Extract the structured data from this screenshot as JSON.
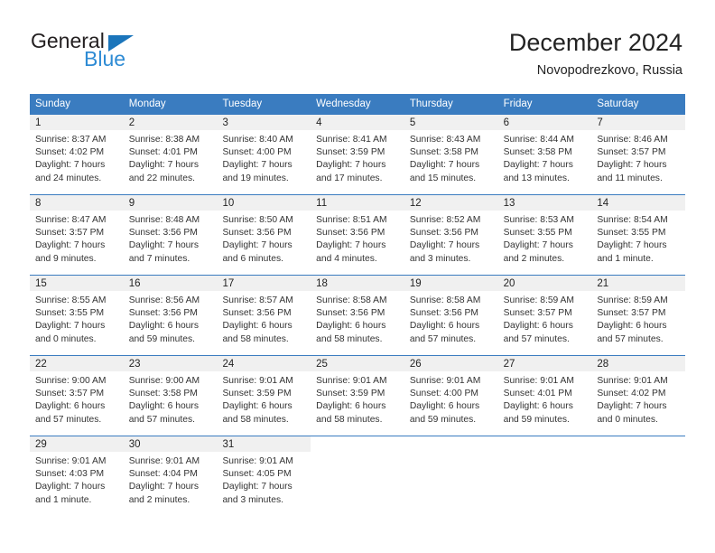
{
  "brand": {
    "name_part1": "General",
    "name_part2": "Blue",
    "accent_color": "#2e8bd4",
    "triangle_color": "#1b75bb"
  },
  "header": {
    "title": "December 2024",
    "subtitle": "Novopodrezkovo, Russia"
  },
  "calendar": {
    "header_bg": "#3a7cc0",
    "daynum_bg": "#f0f0f0",
    "weekdays": [
      "Sunday",
      "Monday",
      "Tuesday",
      "Wednesday",
      "Thursday",
      "Friday",
      "Saturday"
    ],
    "weeks": [
      [
        {
          "day": "1",
          "lines": [
            "Sunrise: 8:37 AM",
            "Sunset: 4:02 PM",
            "Daylight: 7 hours",
            "and 24 minutes."
          ]
        },
        {
          "day": "2",
          "lines": [
            "Sunrise: 8:38 AM",
            "Sunset: 4:01 PM",
            "Daylight: 7 hours",
            "and 22 minutes."
          ]
        },
        {
          "day": "3",
          "lines": [
            "Sunrise: 8:40 AM",
            "Sunset: 4:00 PM",
            "Daylight: 7 hours",
            "and 19 minutes."
          ]
        },
        {
          "day": "4",
          "lines": [
            "Sunrise: 8:41 AM",
            "Sunset: 3:59 PM",
            "Daylight: 7 hours",
            "and 17 minutes."
          ]
        },
        {
          "day": "5",
          "lines": [
            "Sunrise: 8:43 AM",
            "Sunset: 3:58 PM",
            "Daylight: 7 hours",
            "and 15 minutes."
          ]
        },
        {
          "day": "6",
          "lines": [
            "Sunrise: 8:44 AM",
            "Sunset: 3:58 PM",
            "Daylight: 7 hours",
            "and 13 minutes."
          ]
        },
        {
          "day": "7",
          "lines": [
            "Sunrise: 8:46 AM",
            "Sunset: 3:57 PM",
            "Daylight: 7 hours",
            "and 11 minutes."
          ]
        }
      ],
      [
        {
          "day": "8",
          "lines": [
            "Sunrise: 8:47 AM",
            "Sunset: 3:57 PM",
            "Daylight: 7 hours",
            "and 9 minutes."
          ]
        },
        {
          "day": "9",
          "lines": [
            "Sunrise: 8:48 AM",
            "Sunset: 3:56 PM",
            "Daylight: 7 hours",
            "and 7 minutes."
          ]
        },
        {
          "day": "10",
          "lines": [
            "Sunrise: 8:50 AM",
            "Sunset: 3:56 PM",
            "Daylight: 7 hours",
            "and 6 minutes."
          ]
        },
        {
          "day": "11",
          "lines": [
            "Sunrise: 8:51 AM",
            "Sunset: 3:56 PM",
            "Daylight: 7 hours",
            "and 4 minutes."
          ]
        },
        {
          "day": "12",
          "lines": [
            "Sunrise: 8:52 AM",
            "Sunset: 3:56 PM",
            "Daylight: 7 hours",
            "and 3 minutes."
          ]
        },
        {
          "day": "13",
          "lines": [
            "Sunrise: 8:53 AM",
            "Sunset: 3:55 PM",
            "Daylight: 7 hours",
            "and 2 minutes."
          ]
        },
        {
          "day": "14",
          "lines": [
            "Sunrise: 8:54 AM",
            "Sunset: 3:55 PM",
            "Daylight: 7 hours",
            "and 1 minute."
          ]
        }
      ],
      [
        {
          "day": "15",
          "lines": [
            "Sunrise: 8:55 AM",
            "Sunset: 3:55 PM",
            "Daylight: 7 hours",
            "and 0 minutes."
          ]
        },
        {
          "day": "16",
          "lines": [
            "Sunrise: 8:56 AM",
            "Sunset: 3:56 PM",
            "Daylight: 6 hours",
            "and 59 minutes."
          ]
        },
        {
          "day": "17",
          "lines": [
            "Sunrise: 8:57 AM",
            "Sunset: 3:56 PM",
            "Daylight: 6 hours",
            "and 58 minutes."
          ]
        },
        {
          "day": "18",
          "lines": [
            "Sunrise: 8:58 AM",
            "Sunset: 3:56 PM",
            "Daylight: 6 hours",
            "and 58 minutes."
          ]
        },
        {
          "day": "19",
          "lines": [
            "Sunrise: 8:58 AM",
            "Sunset: 3:56 PM",
            "Daylight: 6 hours",
            "and 57 minutes."
          ]
        },
        {
          "day": "20",
          "lines": [
            "Sunrise: 8:59 AM",
            "Sunset: 3:57 PM",
            "Daylight: 6 hours",
            "and 57 minutes."
          ]
        },
        {
          "day": "21",
          "lines": [
            "Sunrise: 8:59 AM",
            "Sunset: 3:57 PM",
            "Daylight: 6 hours",
            "and 57 minutes."
          ]
        }
      ],
      [
        {
          "day": "22",
          "lines": [
            "Sunrise: 9:00 AM",
            "Sunset: 3:57 PM",
            "Daylight: 6 hours",
            "and 57 minutes."
          ]
        },
        {
          "day": "23",
          "lines": [
            "Sunrise: 9:00 AM",
            "Sunset: 3:58 PM",
            "Daylight: 6 hours",
            "and 57 minutes."
          ]
        },
        {
          "day": "24",
          "lines": [
            "Sunrise: 9:01 AM",
            "Sunset: 3:59 PM",
            "Daylight: 6 hours",
            "and 58 minutes."
          ]
        },
        {
          "day": "25",
          "lines": [
            "Sunrise: 9:01 AM",
            "Sunset: 3:59 PM",
            "Daylight: 6 hours",
            "and 58 minutes."
          ]
        },
        {
          "day": "26",
          "lines": [
            "Sunrise: 9:01 AM",
            "Sunset: 4:00 PM",
            "Daylight: 6 hours",
            "and 59 minutes."
          ]
        },
        {
          "day": "27",
          "lines": [
            "Sunrise: 9:01 AM",
            "Sunset: 4:01 PM",
            "Daylight: 6 hours",
            "and 59 minutes."
          ]
        },
        {
          "day": "28",
          "lines": [
            "Sunrise: 9:01 AM",
            "Sunset: 4:02 PM",
            "Daylight: 7 hours",
            "and 0 minutes."
          ]
        }
      ],
      [
        {
          "day": "29",
          "lines": [
            "Sunrise: 9:01 AM",
            "Sunset: 4:03 PM",
            "Daylight: 7 hours",
            "and 1 minute."
          ]
        },
        {
          "day": "30",
          "lines": [
            "Sunrise: 9:01 AM",
            "Sunset: 4:04 PM",
            "Daylight: 7 hours",
            "and 2 minutes."
          ]
        },
        {
          "day": "31",
          "lines": [
            "Sunrise: 9:01 AM",
            "Sunset: 4:05 PM",
            "Daylight: 7 hours",
            "and 3 minutes."
          ]
        },
        {
          "day": "",
          "lines": []
        },
        {
          "day": "",
          "lines": []
        },
        {
          "day": "",
          "lines": []
        },
        {
          "day": "",
          "lines": []
        }
      ]
    ]
  }
}
